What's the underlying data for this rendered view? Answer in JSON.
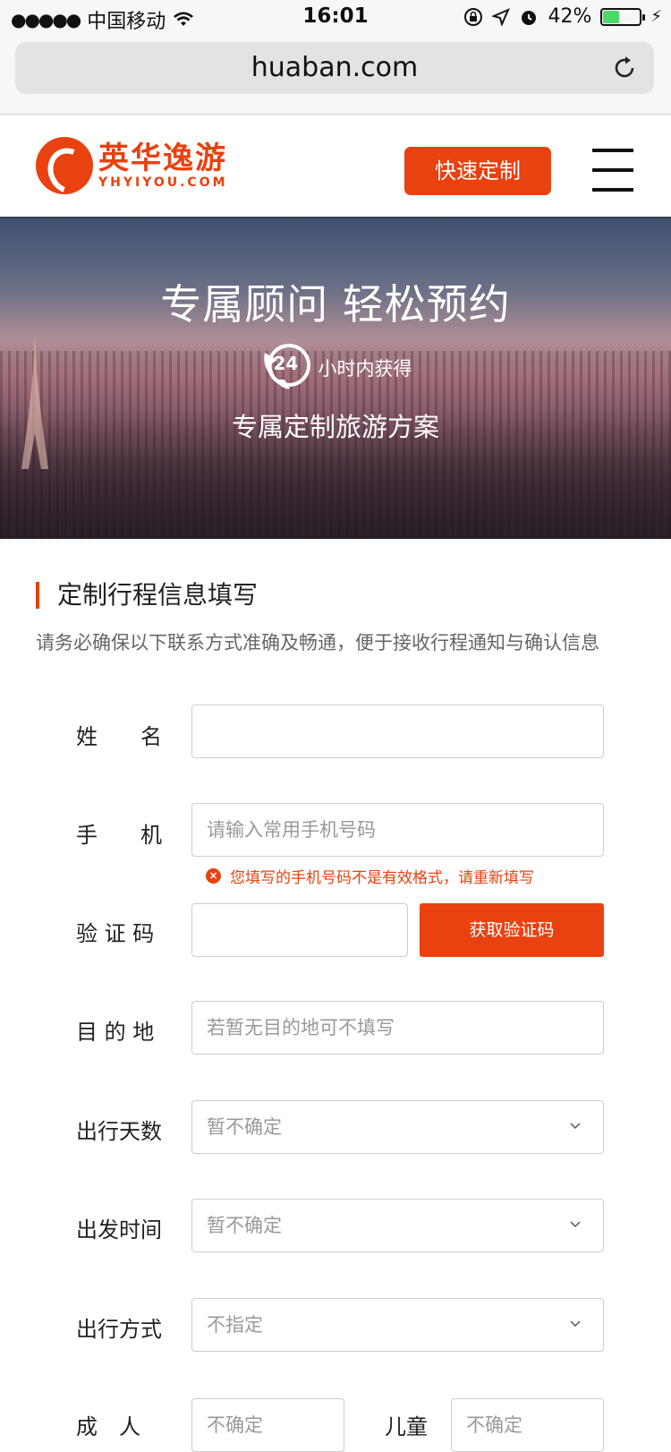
{
  "status": {
    "carrier": "中国移动",
    "time": "16:01",
    "battery": "42%",
    "battery_level": 0.42
  },
  "browser": {
    "url": "huaban.com"
  },
  "header": {
    "logo_cn": "英华逸游",
    "logo_en": "YHYIYOU.COM",
    "quick_button": "快速定制"
  },
  "hero": {
    "title": "专属顾问  轻松预约",
    "badge": "24",
    "subtitle": "小时内获得",
    "subtitle2": "专属定制旅游方案"
  },
  "form": {
    "section_title": "定制行程信息填写",
    "section_desc": "请务必确保以下联系方式准确及畅通，便于接收行程通知与确认信息",
    "name_label": "姓　　名",
    "name_value": "",
    "phone_label": "手　　机",
    "phone_placeholder": "请输入常用手机号码",
    "phone_error": "您填写的手机号码不是有效格式，请重新填写",
    "code_label": "验 证 码",
    "code_button": "获取验证码",
    "dest_label": "目 的 地",
    "dest_placeholder": "若暂无目的地可不填写",
    "days_label": "出行天数",
    "days_value": "暂不确定",
    "depart_label": "出发时间",
    "depart_value": "暂不确定",
    "mode_label": "出行方式",
    "mode_value": "不指定",
    "adult_label": "成　人",
    "adult_value": "不确定",
    "child_label": "儿童",
    "child_value": "不确定"
  }
}
